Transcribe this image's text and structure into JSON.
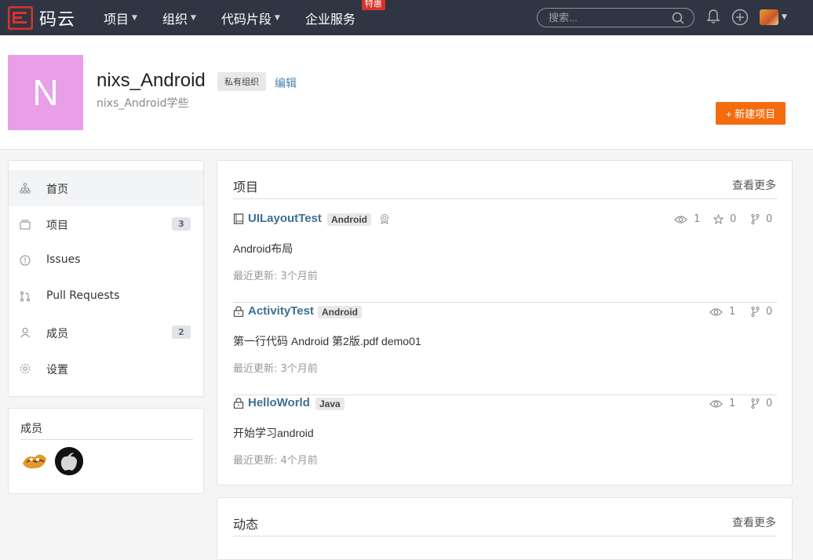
{
  "navbar": {
    "brand": "码云",
    "menu": [
      {
        "label": "项目"
      },
      {
        "label": "组织"
      },
      {
        "label": "代码片段"
      },
      {
        "label": "企业服务",
        "badge": "特惠"
      }
    ],
    "search_placeholder": "搜索...",
    "icons": [
      "bell-icon",
      "plus-circle-icon",
      "user-avatar"
    ]
  },
  "org": {
    "avatar_letter": "N",
    "avatar_color": "#e99ee8",
    "name": "nixs_Android",
    "badge": "私有组织",
    "edit": "编辑",
    "description": "nixs_Android学些",
    "new_project": "+ 新建项目"
  },
  "sidebar": {
    "items": [
      {
        "label": "首页",
        "icon": "sitemap-icon",
        "active": true
      },
      {
        "label": "项目",
        "icon": "folder-icon",
        "count": "3"
      },
      {
        "label": "Issues",
        "icon": "issue-icon"
      },
      {
        "label": "Pull Requests",
        "icon": "pull-request-icon"
      },
      {
        "label": "成员",
        "icon": "user-icon",
        "count": "2"
      },
      {
        "label": "设置",
        "icon": "gear-icon"
      }
    ],
    "members_title": "成员"
  },
  "projects": {
    "title": "项目",
    "more": "查看更多",
    "items": [
      {
        "name": "UILayoutTest",
        "lang": "Android",
        "desc": "Android布局",
        "updated": "最近更新: 3个月前",
        "watch": "1",
        "star": "0",
        "fork": "0",
        "icon": "repo-icon"
      },
      {
        "name": "ActivityTest",
        "lang": "Android",
        "desc": "第一行代码 Android 第2版.pdf demo01",
        "updated": "最近更新: 3个月前",
        "watch": "1",
        "fork": "0",
        "icon": "lock-icon"
      },
      {
        "name": "HelloWorld",
        "lang": "Java",
        "desc": "开始学习android",
        "updated": "最近更新: 4个月前",
        "watch": "1",
        "fork": "0",
        "icon": "lock-icon"
      }
    ]
  },
  "activity": {
    "title": "动态",
    "more": "查看更多"
  },
  "colors": {
    "navbar": "#2f3542",
    "accent": "#f56c0f",
    "link": "#3d6f93",
    "badge": "#d9322b"
  }
}
